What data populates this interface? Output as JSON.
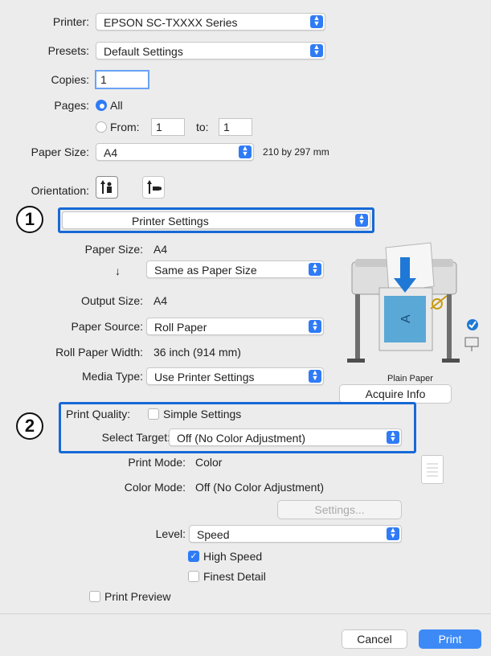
{
  "printer": {
    "label": "Printer:",
    "value": "EPSON SC-TXXXX Series"
  },
  "presets": {
    "label": "Presets:",
    "value": "Default Settings"
  },
  "copies": {
    "label": "Copies:",
    "value": "1"
  },
  "pages": {
    "label": "Pages:",
    "all_label": "All",
    "from_label": "From:",
    "from_value": "1",
    "to_label": "to:",
    "to_value": "1"
  },
  "paper_size": {
    "label": "Paper Size:",
    "value": "A4",
    "dims": "210 by 297 mm"
  },
  "orientation": {
    "label": "Orientation:"
  },
  "annotations": {
    "one": "1",
    "two": "2"
  },
  "section_popup": {
    "value": "Printer Settings"
  },
  "settings": {
    "paper_size_label": "Paper Size:",
    "paper_size_value": "A4",
    "scale_arrow": "↓",
    "scale_value": "Same as Paper Size",
    "output_size_label": "Output Size:",
    "output_size_value": "A4",
    "paper_source_label": "Paper Source:",
    "paper_source_value": "Roll Paper",
    "roll_width_label": "Roll Paper Width:",
    "roll_width_value": "36 inch (914 mm)",
    "media_type_label": "Media Type:",
    "media_type_value": "Use Printer Settings",
    "media_caption": "Plain Paper",
    "acquire_info": "Acquire Info"
  },
  "quality": {
    "print_quality_label": "Print Quality:",
    "simple_settings": "Simple Settings",
    "select_target_label": "Select Target:",
    "select_target_value": "Off (No Color Adjustment)",
    "print_mode_label": "Print Mode:",
    "print_mode_value": "Color",
    "color_mode_label": "Color Mode:",
    "color_mode_value": "Off (No Color Adjustment)",
    "settings_button": "Settings...",
    "level_label": "Level:",
    "level_value": "Speed",
    "high_speed": "High Speed",
    "finest_detail": "Finest Detail"
  },
  "print_preview": "Print Preview",
  "buttons": {
    "cancel": "Cancel",
    "print": "Print"
  },
  "colors": {
    "accent": "#2f7bf5",
    "highlight": "#1769d6"
  }
}
